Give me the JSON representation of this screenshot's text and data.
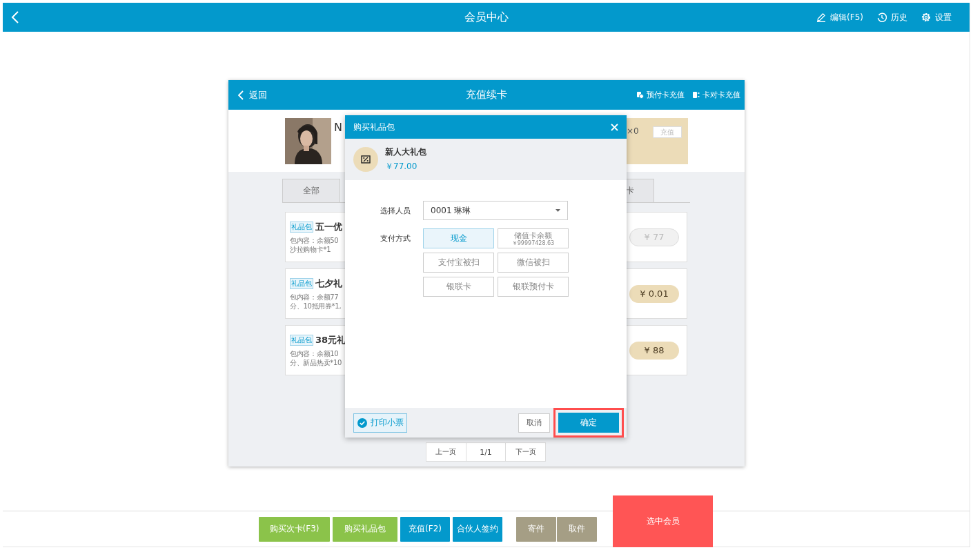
{
  "app_bar": {
    "title": "会员中心",
    "actions": [
      {
        "kind": "edit",
        "label": "编辑(F5)"
      },
      {
        "kind": "history",
        "label": "历史"
      },
      {
        "kind": "settings",
        "label": "设置"
      }
    ]
  },
  "panel": {
    "back": "返回",
    "title": "充值续卡",
    "actions": [
      {
        "kind": "prepaid",
        "label": "预付卡充值"
      },
      {
        "kind": "transfer",
        "label": "卡对卡充值"
      }
    ]
  },
  "member": {
    "name": "N",
    "card_count": "×0",
    "recharge": "充值"
  },
  "tabs": [
    {
      "label": "全部"
    },
    {
      "label": "卡"
    }
  ],
  "packages": [
    {
      "tag": "礼品包",
      "title": "五一优",
      "lines": [
        "包内容：余额50",
        "沙拉购物卡*1"
      ],
      "price": "¥ 77",
      "disabled": true
    },
    {
      "tag": "礼品包",
      "title": "七夕礼",
      "lines": [
        "包内容：余额77",
        "分、10抵用券*1,"
      ],
      "price": "¥ 0.01",
      "disabled": false
    },
    {
      "tag": "礼品包",
      "title": "38元礼",
      "lines": [
        "包内容：余额10",
        "分、新品热卖*10"
      ],
      "price": "¥ 88",
      "disabled": false
    }
  ],
  "pagination": {
    "prev": "上一页",
    "page": "1/1",
    "next": "下一页"
  },
  "dialog": {
    "title": "购买礼品包",
    "item": {
      "name": "新人大礼包",
      "price": "￥77.00"
    },
    "member_label": "选择人员",
    "member_value": "0001 琳琳",
    "payment_label": "支付方式",
    "payment_methods": [
      {
        "label": "现金",
        "selected": true
      },
      {
        "label": "储值卡余额",
        "note": "￥99997428.63",
        "selected": false
      },
      {
        "label": "支付宝被扫",
        "selected": false
      },
      {
        "label": "微信被扫",
        "selected": false
      },
      {
        "label": "银联卡",
        "selected": false
      },
      {
        "label": "银联预付卡",
        "selected": false
      }
    ],
    "print_receipt": {
      "label": "打印小票",
      "checked": true
    },
    "cancel": "取消",
    "confirm": {
      "label": "确定",
      "highlighted": true
    }
  },
  "bottom_buttons": [
    {
      "label": "购买次卡(F3)",
      "color": "#8bc34a"
    },
    {
      "label": "购买礼品包",
      "color": "#8bc34a"
    },
    {
      "label": "充值(F2)",
      "color": "#0399cc"
    },
    {
      "label": "合伙人签约",
      "color": "#0399cc"
    },
    {
      "label": "寄件",
      "color": "#a59e85"
    },
    {
      "label": "取件",
      "color": "#a59e85"
    }
  ],
  "select_member": "选中会员"
}
